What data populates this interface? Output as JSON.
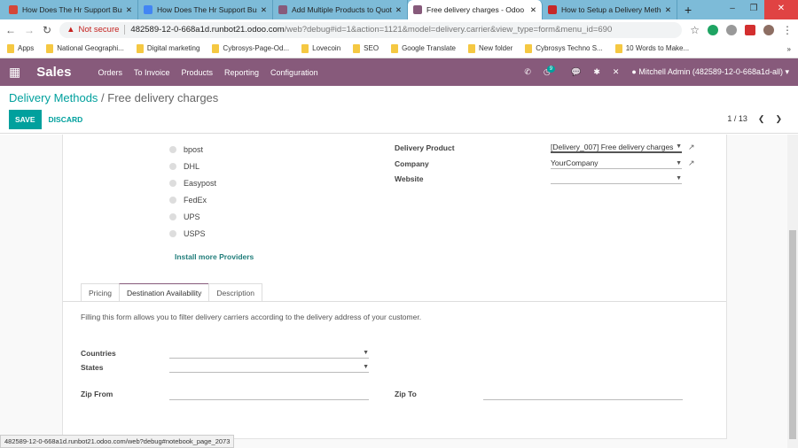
{
  "browser": {
    "tabs": [
      {
        "title": "How Does The Hr Support Busin",
        "icon_color": "#d44638",
        "active": false
      },
      {
        "title": "How Does The Hr Support Busin",
        "icon_color": "#4285f4",
        "active": false
      },
      {
        "title": "Add Multiple Products to Quota",
        "icon_color": "#875a7b",
        "active": false
      },
      {
        "title": "Free delivery charges - Odoo",
        "icon_color": "#875a7b",
        "active": true
      },
      {
        "title": "How to Setup a Delivery Metho",
        "icon_color": "#c62828",
        "active": false
      }
    ],
    "security": "Not secure",
    "url_host": "482589-12-0-668a1d.runbot21.odoo.com",
    "url_path": "/web?debug#id=1&action=1121&model=delivery.carrier&view_type=form&menu_id=690",
    "bookmarks": [
      "Apps",
      "National Geographi...",
      "Digital marketing",
      "Cybrosys-Page-Od...",
      "Lovecoin",
      "SEO",
      "Google Translate",
      "New folder",
      "Cybrosys Techno S...",
      "10 Words to Make..."
    ],
    "status_url": "482589-12-0-668a1d.runbot21.odoo.com/web?debug#notebook_page_2073"
  },
  "navbar": {
    "app": "Sales",
    "menu": [
      "Orders",
      "To Invoice",
      "Products",
      "Reporting",
      "Configuration"
    ],
    "activity_count": "9",
    "user": "Mitchell Admin (482589-12-0-668a1d-all)"
  },
  "control": {
    "breadcrumb_parent": "Delivery Methods",
    "breadcrumb_current": "Free delivery charges",
    "save": "SAVE",
    "discard": "DISCARD",
    "pager": "1 / 13"
  },
  "form": {
    "providers": [
      "bpost",
      "DHL",
      "Easypost",
      "FedEx",
      "UPS",
      "USPS"
    ],
    "install_more": "Install more Providers",
    "delivery_product_label": "Delivery Product",
    "delivery_product_value": "[Delivery_007] Free delivery charges",
    "company_label": "Company",
    "company_value": "YourCompany",
    "website_label": "Website",
    "website_value": "",
    "tabs": [
      "Pricing",
      "Destination Availability",
      "Description"
    ],
    "active_tab": "Destination Availability",
    "help": "Filling this form allows you to filter delivery carriers according to the delivery address of your customer.",
    "countries_label": "Countries",
    "states_label": "States",
    "zip_from_label": "Zip From",
    "zip_to_label": "Zip To"
  },
  "colors": {
    "brand": "#875a7b",
    "accent": "#00a09d"
  }
}
